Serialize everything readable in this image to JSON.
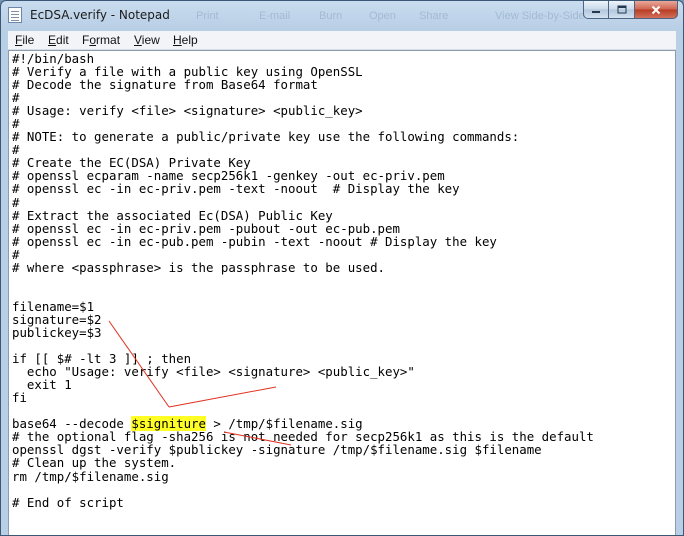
{
  "window": {
    "title": "EcDSA.verify - Notepad",
    "background_ghost_texts": [
      "Print",
      "E-mail",
      "Burn",
      "Open",
      "Share",
      "View Side-by-Side"
    ]
  },
  "caption_buttons": {
    "minimize_icon": "minimize-icon",
    "maximize_icon": "maximize-icon",
    "close_icon": "close-icon"
  },
  "menu": {
    "items": [
      {
        "key": "F",
        "rest": "ile"
      },
      {
        "key": "E",
        "rest": "dit"
      },
      {
        "key": "",
        "pre": "F",
        "key2": "o",
        "rest": "rmat"
      },
      {
        "key": "V",
        "rest": "iew"
      },
      {
        "key": "H",
        "rest": "elp"
      }
    ]
  },
  "document": {
    "lines_before_highlight": "#!/bin/bash\n# Verify a file with a public key using OpenSSL\n# Decode the signature from Base64 format\n#\n# Usage: verify <file> <signature> <public_key>\n#\n# NOTE: to generate a public/private key use the following commands:\n#\n# Create the EC(DSA) Private Key\n# openssl ecparam -name secp256k1 -genkey -out ec-priv.pem\n# openssl ec -in ec-priv.pem -text -noout  # Display the key\n#\n# Extract the associated Ec(DSA) Public Key\n# openssl ec -in ec-priv.pem -pubout -out ec-pub.pem\n# openssl ec -in ec-pub.pem -pubin -text -noout # Display the key\n#\n# where <passphrase> is the passphrase to be used.\n\n\nfilename=$1\nsignature=$2\npublickey=$3\n\nif [[ $# -lt 3 ]] ; then\n  echo \"Usage: verify <file> <signature> <public_key>\"\n  exit 1\nfi\n\nbase64 --decode ",
    "highlighted_token": "$signiture",
    "lines_after_highlight": " > /tmp/$filename.sig\n# the optional flag -sha256 is not needed for secp256k1 as this is the default\nopenssl dgst -verify $publickey -signature /tmp/$filename.sig $filename\n# Clean up the system.\nrm /tmp/$filename.sig\n\n# End of script",
    "highlight_color": "#ffff26",
    "annotation_color": "#e03020"
  }
}
